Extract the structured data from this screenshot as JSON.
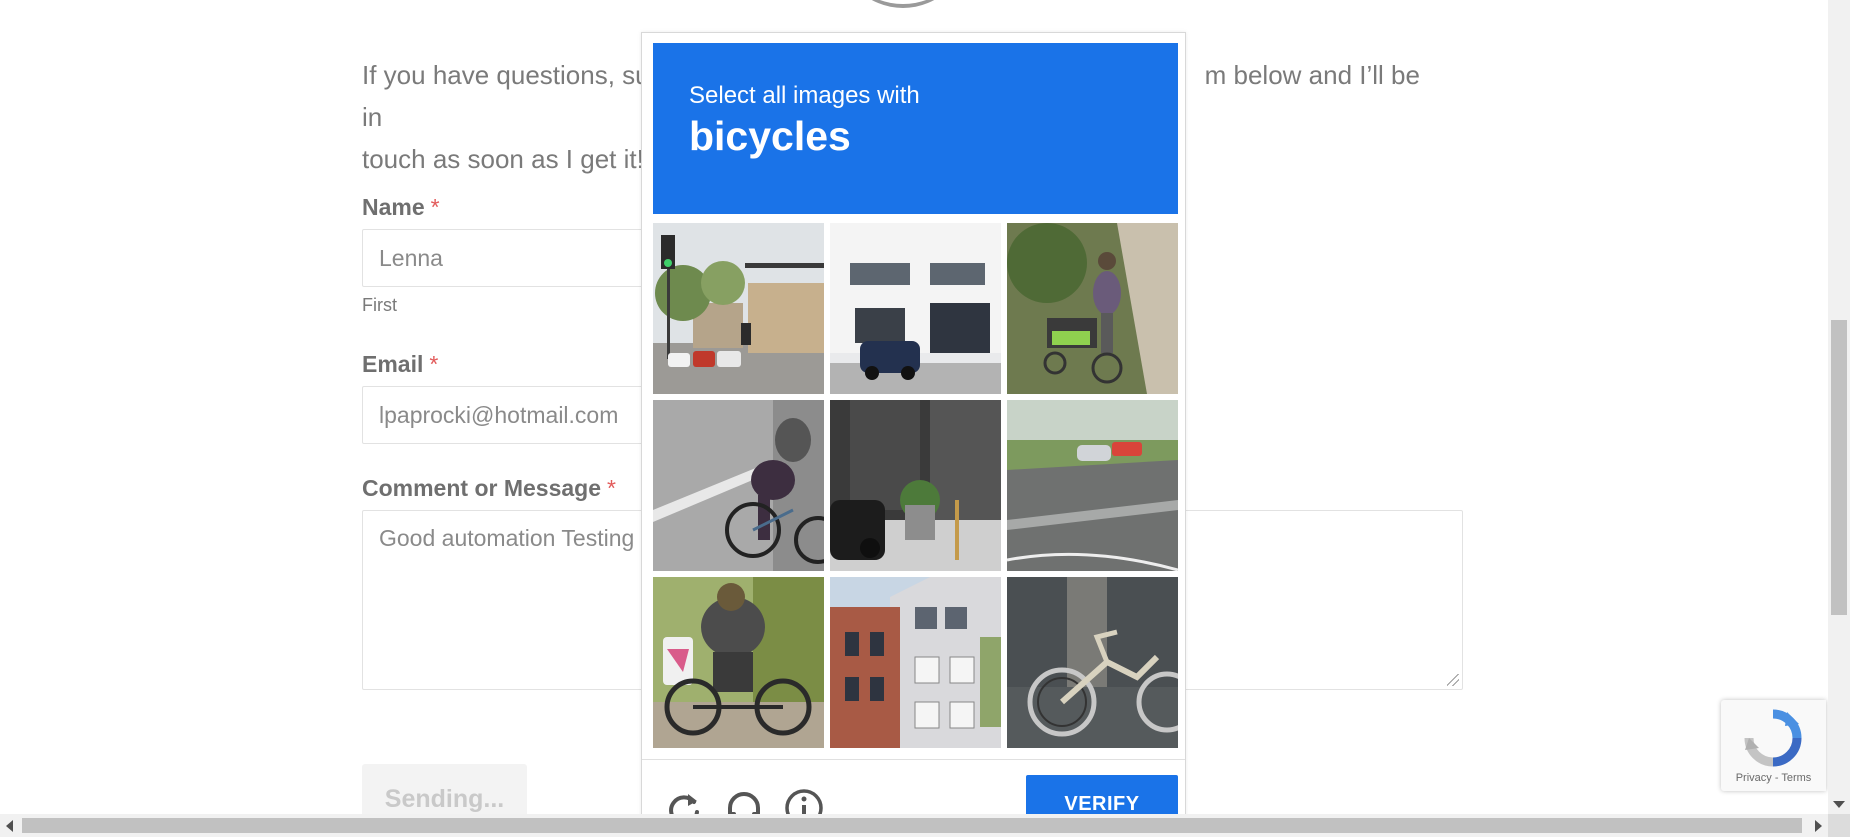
{
  "page": {
    "intro_part1": "If you have questions, su",
    "intro_part2": "m below and I’ll be in",
    "intro_line2": "touch as soon as I get it!"
  },
  "form": {
    "name_label": "Name",
    "name_value": "Lenna",
    "name_sublabel": "First",
    "email_label": "Email",
    "email_value": "lpaprocki@hotmail.com",
    "comment_label": "Comment or Message",
    "comment_value": "Good automation Testing",
    "required_mark": "*",
    "submit_label": "Sending..."
  },
  "captcha": {
    "instruction": "Select all images with",
    "target": "bicycles",
    "tiles": [
      {
        "subject": "street-with-traffic-lights"
      },
      {
        "subject": "white-building-with-car"
      },
      {
        "subject": "person-riding-cargo-bicycle"
      },
      {
        "subject": "cyclist-on-road"
      },
      {
        "subject": "building-entrance-with-planters"
      },
      {
        "subject": "highway-with-cars"
      },
      {
        "subject": "person-on-bicycle-with-bags"
      },
      {
        "subject": "brick-apartment-house"
      },
      {
        "subject": "parked-bmx-bicycle"
      }
    ],
    "verify_label": "VERIFY",
    "icons": [
      "reload-icon",
      "audio-icon",
      "info-icon"
    ]
  },
  "badge": {
    "privacy": "Privacy",
    "separator": " - ",
    "terms": "Terms"
  },
  "colors": {
    "captcha_blue": "#1a73e8",
    "required_red": "#e25b5b"
  }
}
